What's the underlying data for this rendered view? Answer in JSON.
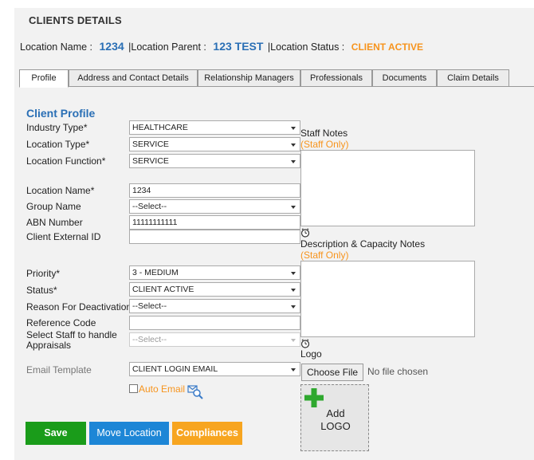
{
  "header": {
    "title": "CLIENTS DETAILS",
    "location_name_label": "Location Name :",
    "location_name_value": "1234",
    "location_parent_label": "|Location Parent :",
    "location_parent_value": "123 TEST",
    "location_status_label": "|Location Status :",
    "location_status_value": "CLIENT ACTIVE"
  },
  "tabs": [
    {
      "label": "Profile",
      "active": true
    },
    {
      "label": "Address and Contact Details",
      "active": false
    },
    {
      "label": "Relationship Managers",
      "active": false
    },
    {
      "label": "Professionals",
      "active": false
    },
    {
      "label": "Documents",
      "active": false
    },
    {
      "label": "Claim Details",
      "active": false
    }
  ],
  "profile": {
    "section_title": "Client Profile",
    "industry_type": {
      "label": "Industry Type*",
      "value": "HEALTHCARE"
    },
    "location_type": {
      "label": "Location Type*",
      "value": "SERVICE"
    },
    "location_function": {
      "label": "Location Function*",
      "value": "SERVICE"
    },
    "location_name": {
      "label": "Location Name*",
      "value": "1234"
    },
    "group_name": {
      "label": "Group Name",
      "value": "--Select--"
    },
    "abn_number": {
      "label": "ABN Number",
      "value": "11111111111"
    },
    "client_external_id": {
      "label": "Client External ID",
      "value": ""
    },
    "priority": {
      "label": "Priority*",
      "value": "3 - MEDIUM"
    },
    "status": {
      "label": "Status*",
      "value": "CLIENT ACTIVE"
    },
    "reason_for_deactivation": {
      "label": "Reason For Deactivation",
      "value": "--Select--"
    },
    "reference_code": {
      "label": "Reference Code",
      "value": ""
    },
    "select_staff": {
      "label_line1": "Select Staff to handle",
      "label_line2": "Appraisals",
      "value": "--Select--"
    },
    "email_template": {
      "label": "Email Template",
      "value": "CLIENT LOGIN EMAIL"
    },
    "auto_email": {
      "label": "Auto Email",
      "checked": false
    }
  },
  "notes": {
    "staff_notes_label": "Staff Notes",
    "staff_only": "(Staff Only)",
    "description_label": "Description & Capacity Notes",
    "description_staff_only": "(Staff Only)",
    "logo_label": "Logo",
    "choose_file": "Choose File",
    "no_file": "No file chosen",
    "add_logo_line1": "Add",
    "add_logo_line2": "LOGO"
  },
  "buttons": {
    "save": "Save",
    "move_location": "Move Location",
    "compliances": "Compliances"
  },
  "colors": {
    "accent_blue": "#2a6fb5",
    "status_orange": "#f7941d",
    "save_green": "#1a9c1a",
    "move_blue": "#1d86d6",
    "compliance_orange": "#f7a520"
  },
  "icons": [
    "clock-icon",
    "search-email-icon",
    "add-plus-icon",
    "chevron-down-icon"
  ]
}
